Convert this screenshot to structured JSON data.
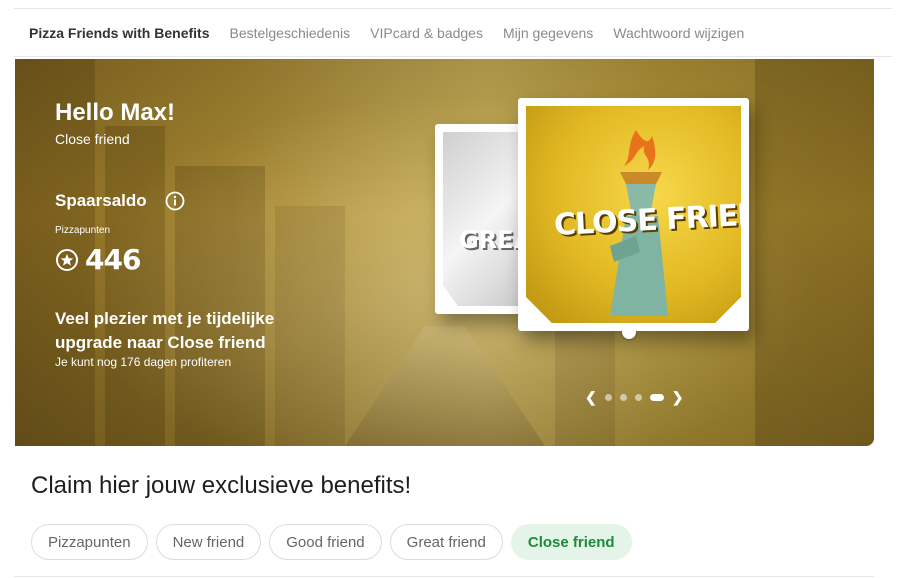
{
  "nav": {
    "tabs": [
      {
        "label": "Pizza Friends with Benefits",
        "active": true
      },
      {
        "label": "Bestelgeschiedenis",
        "active": false
      },
      {
        "label": "VIPcard & badges",
        "active": false
      },
      {
        "label": "Mijn gegevens",
        "active": false
      },
      {
        "label": "Wachtwoord wijzigen",
        "active": false
      }
    ]
  },
  "hero": {
    "greeting": "Hello Max!",
    "status": "Close friend",
    "savings_title": "Spaarsaldo",
    "points_label": "Pizzapunten",
    "points_value": "446",
    "upgrade_text": "Veel plezier met je tijdelijke upgrade naar Close friend",
    "days_remaining": "Je kunt nog 176 dagen profiteren",
    "card_back_text": "GREAT",
    "card_front_text": "CLOSE FRIEND",
    "carousel": {
      "total": 4,
      "active_index": 3
    }
  },
  "claim": {
    "heading": "Claim hier jouw exclusieve benefits!",
    "filters": [
      {
        "label": "Pizzapunten",
        "active": false
      },
      {
        "label": "New friend",
        "active": false
      },
      {
        "label": "Good friend",
        "active": false
      },
      {
        "label": "Great friend",
        "active": false
      },
      {
        "label": "Close friend",
        "active": true
      }
    ]
  },
  "colors": {
    "accent_green": "#1f8a3a",
    "chip_active_bg": "#e5f4e8",
    "gold": "#c8ad55"
  },
  "icons": [
    "info-icon",
    "star-coin-icon",
    "chevron-left-icon",
    "chevron-right-icon",
    "torch-icon"
  ]
}
